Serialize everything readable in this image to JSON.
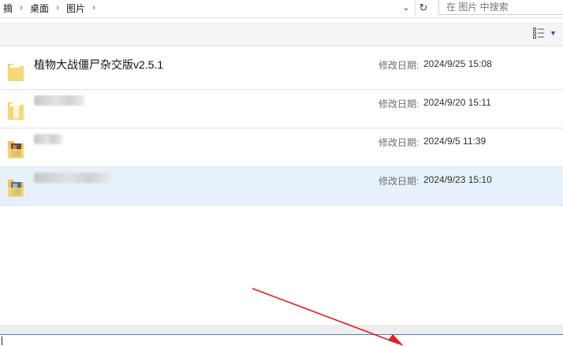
{
  "breadcrumb": {
    "items": [
      "摘",
      "桌面",
      "图片"
    ],
    "separator": "›"
  },
  "search": {
    "placeholder": "在 图片 中搜索"
  },
  "icons": {
    "dropdown": "⌄",
    "refresh": "↻",
    "view_caret": "▼"
  },
  "files": [
    {
      "name": "植物大战僵尸杂交版v2.5.1",
      "date_label": "修改日期:",
      "date": "2024/9/25 15:08"
    },
    {
      "name": "",
      "date_label": "修改日期:",
      "date": "2024/9/20 15:11"
    },
    {
      "name": "",
      "date_label": "修改日期:",
      "date": "2024/9/5 11:39"
    },
    {
      "name": "",
      "date_label": "修改日期:",
      "date": "2024/9/23 15:10"
    }
  ],
  "colors": {
    "selected_row": "#e6f1fb",
    "accent": "#2b5797",
    "annotation_arrow": "#e02020"
  }
}
